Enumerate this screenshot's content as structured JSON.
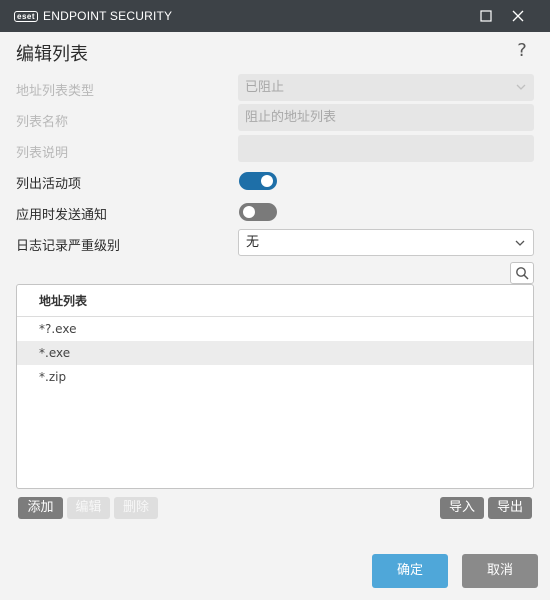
{
  "titlebar": {
    "brand_badge": "eset",
    "brand_text": "ENDPOINT SECURITY"
  },
  "dialog": {
    "title": "编辑列表",
    "help": "?"
  },
  "form": {
    "list_type": {
      "label": "地址列表类型",
      "value": "已阻止"
    },
    "list_name": {
      "label": "列表名称",
      "value": "阻止的地址列表"
    },
    "list_description": {
      "label": "列表说明",
      "value": ""
    },
    "list_active": {
      "label": "列出活动项",
      "state": "on"
    },
    "notify_on_apply": {
      "label": "应用时发送通知",
      "state": "off"
    },
    "log_severity": {
      "label": "日志记录严重级别",
      "value": "无"
    }
  },
  "address_list": {
    "header": "地址列表",
    "items": [
      "*?.exe",
      "*.exe",
      "*.zip"
    ],
    "selected_index": 1
  },
  "list_buttons": {
    "add": "添加",
    "edit": "编辑",
    "delete": "删除",
    "import": "导入",
    "export": "导出"
  },
  "footer": {
    "ok": "确定",
    "cancel": "取消"
  },
  "colors": {
    "titlebar": "#3d4247",
    "toggle_on": "#1e6fa8",
    "primary_button": "#4fa7d9"
  }
}
